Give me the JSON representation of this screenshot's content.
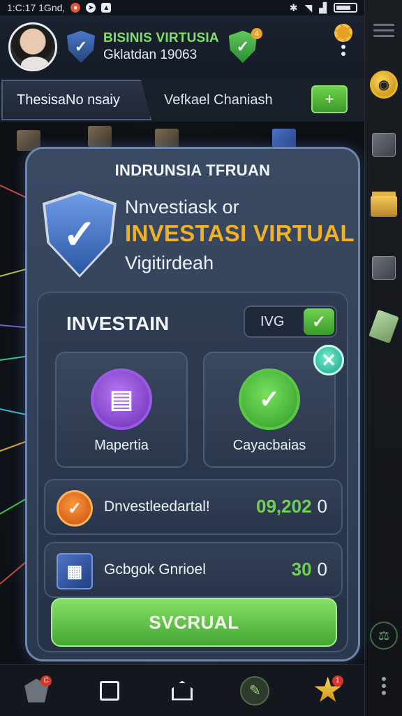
{
  "status_bar": {
    "time": "1:C:17 1Gnd,",
    "icons": [
      "notification-icon",
      "compass-icon",
      "gallery-icon",
      "bluetooth-icon",
      "wifi-icon",
      "signal-icon",
      "battery-icon"
    ]
  },
  "header": {
    "app_name": "BISINIS VIRTUSIA",
    "app_sub": "Gklatdan 19063",
    "badge": "4"
  },
  "tabs": {
    "active": "ThesisaNo nsaiy",
    "inactive": "Vefkael Chaniash",
    "add_icon": "+"
  },
  "card": {
    "title": "INDRUNSIA TFRUAN",
    "line1": "Nnvestiask or",
    "line2": "INVESTASI VIRTUAL",
    "line3": "Vigitirdeah",
    "section_title": "INVESTAIN",
    "toggle_label": "IVG",
    "tiles": [
      {
        "label": "Mapertia"
      },
      {
        "label": "Cayacbaias"
      }
    ],
    "rows": [
      {
        "label": "Dnvestleedartal!",
        "value": "09,202",
        "suffix": "0"
      },
      {
        "label": "Gcbgok Gnrioel",
        "value": "30",
        "suffix": "0"
      }
    ],
    "submit_label": "SVCRUAL"
  },
  "bottom_nav": {
    "badge_left": "C",
    "badge_right": "1"
  },
  "colors": {
    "accent_green": "#6fd24e",
    "accent_gold": "#f0b126",
    "card_bg": "#3a4a63"
  }
}
